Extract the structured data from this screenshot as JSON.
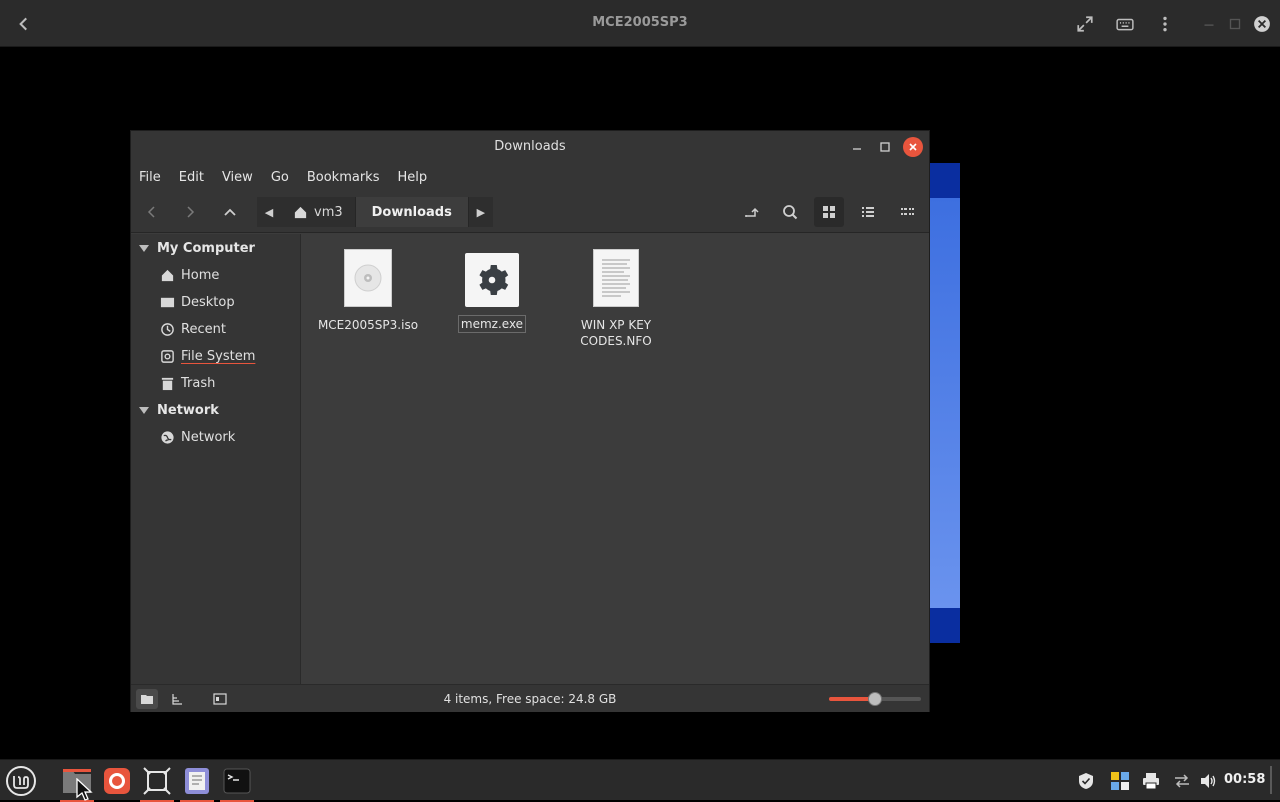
{
  "viewer": {
    "title": "MCE2005SP3"
  },
  "window": {
    "title": "Downloads"
  },
  "menu": [
    "File",
    "Edit",
    "View",
    "Go",
    "Bookmarks",
    "Help"
  ],
  "path": {
    "home": "vm3",
    "current": "Downloads"
  },
  "sidebar": {
    "my_computer": "My Computer",
    "network_heading": "Network",
    "items": [
      {
        "label": "Home",
        "icon": "home-icon"
      },
      {
        "label": "Desktop",
        "icon": "desktop-icon"
      },
      {
        "label": "Recent",
        "icon": "recent-icon"
      },
      {
        "label": "File System",
        "icon": "filesystem-icon"
      },
      {
        "label": "Trash",
        "icon": "trash-icon"
      }
    ],
    "network_items": [
      {
        "label": "Network",
        "icon": "network-icon"
      }
    ]
  },
  "files": [
    {
      "name": "MCE2005SP3.iso",
      "icon": "disc-image-icon"
    },
    {
      "name": "memz.exe",
      "icon": "executable-gear-icon",
      "selected": true
    },
    {
      "name_line1": "WIN XP KEY",
      "name_line2": "CODES.NFO",
      "icon": "text-document-icon"
    }
  ],
  "status": {
    "text": "4 items, Free space: 24.8 GB",
    "zoom_fraction": 0.5
  },
  "taskbar": {
    "clock": "00:58"
  },
  "colors": {
    "accent": "#e8553d",
    "window_bg": "#3c3c3c",
    "panel_bg": "#353535"
  }
}
